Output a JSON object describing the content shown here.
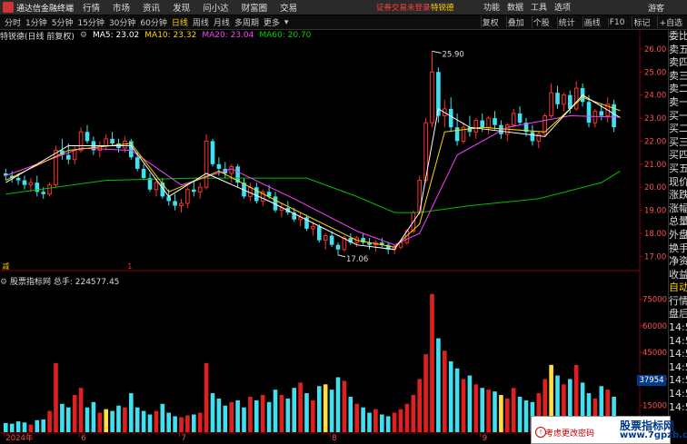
{
  "titlebar": {
    "app_title": "通达信金融终端",
    "menu": [
      "行情",
      "市场",
      "资讯",
      "发现",
      "问小达",
      "财富圈",
      "交易"
    ],
    "notice": "证券交易未登录",
    "stock_name": "特锐德",
    "right_menu": [
      "功能",
      "数据",
      "工具",
      "选项"
    ],
    "guest": "游客"
  },
  "toolbar": {
    "periods": [
      "分时",
      "1分钟",
      "5分钟",
      "15分钟",
      "30分钟",
      "60分钟",
      "日线",
      "周线",
      "月线",
      "多周期",
      "更多"
    ],
    "active_period": "日线",
    "tools": [
      "复权",
      "叠加",
      "个股",
      "统计",
      "画线",
      "F10",
      "标记",
      "+自选"
    ]
  },
  "main_info": {
    "label": "特锐德(日线 前复权)",
    "ma5": "MA5: 23.02",
    "ma10": "MA10: 23.32",
    "ma20": "MA20: 23.04",
    "ma60": "MA60: 20.70",
    "colors": {
      "ma5": "#ffffff",
      "ma10": "#ffd700",
      "ma20": "#ff40ff",
      "ma60": "#00d000"
    }
  },
  "vol_info": {
    "label": "股票指标网",
    "total": "总手: 224577.45"
  },
  "chart_data": {
    "type": "candlestick",
    "price_ticks": [
      "26.00",
      "25.00",
      "24.00",
      "23.00",
      "22.00",
      "21.00",
      "20.00",
      "19.00",
      "18.00",
      "17.00"
    ],
    "price_range": [
      16.7,
      26.35
    ],
    "vol_ticks": [
      "75000",
      "60000",
      "45000",
      "30000",
      "15000"
    ],
    "vol_range": [
      0,
      82000
    ],
    "vol_marker": "37954",
    "x_labels": [
      "2024年",
      "6",
      "7",
      "8",
      "9",
      "10",
      "11"
    ],
    "x_label_index": [
      0,
      12,
      28,
      52,
      76,
      95,
      118
    ],
    "high_label": "25.90",
    "low_label": "17.06",
    "markers": [
      {
        "text": "减",
        "index": 0,
        "color": "#ffd000"
      },
      {
        "text": "1",
        "index": 20,
        "color": "#ff3030"
      },
      {
        "text": "财",
        "index": 110,
        "color": "#4aa0ff"
      }
    ],
    "candles": [
      [
        20.6,
        20.8,
        20.3,
        20.5
      ],
      [
        20.5,
        20.7,
        20.2,
        20.4
      ],
      [
        20.4,
        20.6,
        20.1,
        20.3
      ],
      [
        20.3,
        20.5,
        19.9,
        20.1
      ],
      [
        20.1,
        20.4,
        19.8,
        20.2
      ],
      [
        20.2,
        20.5,
        19.6,
        19.8
      ],
      [
        19.8,
        20.0,
        19.5,
        19.7
      ],
      [
        19.7,
        20.2,
        19.6,
        20.1
      ],
      [
        20.1,
        21.8,
        20.0,
        21.6
      ],
      [
        21.6,
        22.1,
        21.2,
        21.4
      ],
      [
        21.4,
        21.9,
        21.0,
        21.2
      ],
      [
        21.2,
        21.8,
        21.0,
        21.6
      ],
      [
        21.6,
        22.6,
        21.5,
        22.4
      ],
      [
        22.4,
        22.7,
        21.9,
        22.0
      ],
      [
        22.0,
        22.2,
        21.4,
        21.6
      ],
      [
        21.6,
        22.0,
        21.3,
        21.8
      ],
      [
        21.8,
        22.3,
        21.6,
        22.1
      ],
      [
        22.1,
        22.4,
        21.8,
        21.9
      ],
      [
        21.9,
        22.1,
        21.5,
        21.7
      ],
      [
        21.7,
        22.2,
        21.5,
        22.0
      ],
      [
        22.0,
        22.1,
        21.2,
        21.3
      ],
      [
        21.3,
        21.5,
        20.7,
        20.8
      ],
      [
        20.8,
        21.0,
        20.3,
        20.4
      ],
      [
        20.4,
        20.6,
        19.8,
        19.9
      ],
      [
        19.9,
        20.3,
        19.6,
        20.2
      ],
      [
        20.2,
        20.4,
        19.5,
        19.6
      ],
      [
        19.6,
        19.9,
        19.2,
        19.4
      ],
      [
        19.4,
        19.7,
        19.0,
        19.2
      ],
      [
        19.2,
        19.5,
        18.9,
        19.3
      ],
      [
        19.3,
        20.0,
        19.1,
        19.9
      ],
      [
        19.9,
        20.3,
        19.6,
        19.8
      ],
      [
        19.8,
        20.2,
        19.5,
        20.0
      ],
      [
        20.0,
        22.3,
        19.9,
        22.0
      ],
      [
        22.0,
        22.1,
        20.9,
        21.0
      ],
      [
        21.0,
        21.3,
        20.5,
        20.8
      ],
      [
        20.8,
        21.1,
        20.4,
        20.6
      ],
      [
        20.6,
        21.0,
        20.2,
        20.9
      ],
      [
        20.9,
        21.0,
        20.0,
        20.2
      ],
      [
        20.2,
        20.4,
        19.5,
        19.6
      ],
      [
        19.6,
        20.2,
        19.4,
        20.0
      ],
      [
        20.0,
        20.2,
        19.3,
        19.4
      ],
      [
        19.4,
        19.9,
        19.2,
        19.8
      ],
      [
        19.8,
        20.1,
        19.5,
        19.6
      ],
      [
        19.6,
        19.8,
        18.9,
        19.0
      ],
      [
        19.0,
        19.3,
        18.7,
        19.1
      ],
      [
        19.1,
        19.4,
        18.8,
        18.9
      ],
      [
        18.9,
        19.1,
        18.5,
        18.6
      ],
      [
        18.6,
        18.9,
        18.3,
        18.7
      ],
      [
        18.7,
        18.8,
        18.1,
        18.2
      ],
      [
        18.2,
        18.5,
        17.9,
        18.3
      ],
      [
        18.3,
        18.4,
        17.6,
        17.7
      ],
      [
        17.7,
        18.0,
        17.3,
        17.9
      ],
      [
        17.9,
        18.1,
        17.4,
        17.5
      ],
      [
        17.5,
        17.6,
        17.06,
        17.3
      ],
      [
        17.3,
        17.9,
        17.2,
        17.8
      ],
      [
        17.8,
        18.0,
        17.5,
        17.6
      ],
      [
        17.6,
        17.9,
        17.4,
        17.8
      ],
      [
        17.8,
        18.0,
        17.5,
        17.6
      ],
      [
        17.6,
        17.8,
        17.3,
        17.5
      ],
      [
        17.5,
        17.7,
        17.2,
        17.6
      ],
      [
        17.6,
        17.8,
        17.4,
        17.5
      ],
      [
        17.5,
        17.6,
        17.1,
        17.3
      ],
      [
        17.3,
        17.5,
        17.1,
        17.4
      ],
      [
        17.4,
        17.7,
        17.3,
        17.6
      ],
      [
        17.6,
        18.2,
        17.5,
        18.1
      ],
      [
        18.1,
        19.0,
        18.0,
        18.9
      ],
      [
        18.9,
        20.5,
        18.8,
        20.3
      ],
      [
        20.3,
        23.0,
        20.2,
        22.8
      ],
      [
        22.8,
        25.9,
        22.6,
        25.0
      ],
      [
        25.0,
        25.2,
        22.8,
        23.1
      ],
      [
        23.1,
        23.8,
        22.6,
        23.4
      ],
      [
        23.4,
        23.9,
        22.4,
        22.6
      ],
      [
        22.6,
        23.2,
        21.8,
        22.0
      ],
      [
        22.0,
        22.8,
        21.9,
        22.6
      ],
      [
        22.6,
        23.1,
        22.2,
        22.4
      ],
      [
        22.4,
        23.0,
        22.1,
        22.9
      ],
      [
        22.9,
        23.2,
        22.4,
        22.6
      ],
      [
        22.6,
        23.1,
        22.3,
        23.0
      ],
      [
        23.0,
        23.3,
        22.5,
        22.7
      ],
      [
        22.7,
        22.9,
        22.1,
        22.3
      ],
      [
        22.3,
        22.8,
        22.0,
        22.7
      ],
      [
        22.7,
        23.4,
        22.6,
        23.2
      ],
      [
        23.2,
        23.5,
        22.7,
        22.8
      ],
      [
        22.8,
        23.0,
        22.2,
        22.4
      ],
      [
        22.4,
        22.7,
        21.8,
        22.0
      ],
      [
        22.0,
        22.4,
        21.7,
        22.3
      ],
      [
        22.3,
        23.2,
        22.2,
        23.1
      ],
      [
        23.1,
        24.5,
        23.0,
        24.1
      ],
      [
        24.1,
        24.4,
        23.4,
        23.6
      ],
      [
        23.6,
        24.1,
        23.3,
        24.0
      ],
      [
        24.0,
        24.2,
        23.2,
        23.4
      ],
      [
        23.4,
        24.6,
        23.3,
        24.3
      ],
      [
        24.3,
        24.5,
        23.5,
        23.7
      ],
      [
        23.7,
        24.0,
        22.6,
        22.8
      ],
      [
        22.8,
        23.4,
        22.6,
        23.3
      ],
      [
        23.3,
        23.6,
        22.9,
        23.1
      ],
      [
        23.1,
        23.9,
        22.8,
        23.6
      ],
      [
        23.6,
        23.8,
        22.4,
        22.6
      ]
    ],
    "volumes": [
      5200,
      4800,
      6100,
      5500,
      4300,
      6800,
      7200,
      12000,
      39000,
      16000,
      14000,
      21000,
      25000,
      14000,
      17000,
      11000,
      13000,
      12000,
      15000,
      14000,
      22000,
      14000,
      12000,
      10000,
      12000,
      16000,
      11000,
      9000,
      8500,
      9500,
      10000,
      11000,
      39000,
      22000,
      19000,
      15000,
      17000,
      18000,
      14000,
      20000,
      18000,
      21000,
      17000,
      24000,
      21000,
      19000,
      25000,
      28000,
      22000,
      18000,
      26000,
      27000,
      24000,
      31000,
      29000,
      20000,
      16000,
      14000,
      11000,
      13000,
      10000,
      9000,
      11000,
      13000,
      16000,
      21000,
      30000,
      44000,
      78000,
      53000,
      46000,
      40000,
      36000,
      30000,
      32000,
      27000,
      25000,
      24000,
      23000,
      21000,
      19000,
      25000,
      20000,
      18000,
      17000,
      22000,
      30000,
      38000,
      32000,
      27000,
      30000,
      37954,
      28000,
      22000,
      19000,
      26000,
      24000,
      20000
    ],
    "yellow_vol_index": [
      16,
      51,
      79,
      87
    ],
    "ma_series": {
      "ma60": [
        [
          0,
          19.7
        ],
        [
          16,
          20.3
        ],
        [
          30,
          20.4
        ],
        [
          48,
          20.4
        ],
        [
          56,
          19.6
        ],
        [
          62,
          18.9
        ],
        [
          66,
          18.9
        ],
        [
          74,
          19.2
        ],
        [
          85,
          19.5
        ],
        [
          95,
          20.2
        ],
        [
          98,
          20.7
        ]
      ],
      "ma20": [
        [
          0,
          20.5
        ],
        [
          12,
          21.7
        ],
        [
          20,
          21.6
        ],
        [
          28,
          20.1
        ],
        [
          36,
          20.8
        ],
        [
          46,
          19.5
        ],
        [
          56,
          18.1
        ],
        [
          62,
          17.5
        ],
        [
          66,
          18.0
        ],
        [
          72,
          21.4
        ],
        [
          80,
          22.6
        ],
        [
          90,
          23.1
        ],
        [
          98,
          23.04
        ]
      ],
      "ma10": [
        [
          0,
          20.3
        ],
        [
          10,
          21.6
        ],
        [
          20,
          21.9
        ],
        [
          26,
          19.8
        ],
        [
          34,
          20.7
        ],
        [
          44,
          19.3
        ],
        [
          56,
          17.7
        ],
        [
          62,
          17.4
        ],
        [
          66,
          18.4
        ],
        [
          70,
          22.4
        ],
        [
          76,
          22.6
        ],
        [
          86,
          22.4
        ],
        [
          92,
          23.9
        ],
        [
          98,
          23.32
        ]
      ],
      "ma5": [
        [
          0,
          20.2
        ],
        [
          10,
          21.8
        ],
        [
          20,
          21.8
        ],
        [
          26,
          19.6
        ],
        [
          32,
          20.6
        ],
        [
          42,
          19.4
        ],
        [
          56,
          17.5
        ],
        [
          62,
          17.3
        ],
        [
          66,
          18.9
        ],
        [
          69,
          23.4
        ],
        [
          74,
          22.6
        ],
        [
          86,
          22.2
        ],
        [
          92,
          24.0
        ],
        [
          98,
          23.02
        ]
      ]
    }
  },
  "right_panel": {
    "items": [
      "委比",
      "卖五",
      "卖四",
      "卖三",
      "卖二",
      "卖一",
      "买一",
      "买二",
      "买三",
      "买四",
      "买五",
      "现价",
      "涨跌",
      "涨幅",
      "总量",
      "外盘",
      "换手",
      "净资",
      "收益",
      "",
      "自动",
      "行情",
      "盘后",
      "14:50",
      "14:50",
      "14:50",
      "14:50",
      "14:50",
      "14:50",
      "14:50"
    ],
    "colors": [
      "#ddd",
      "#ddd",
      "#ddd",
      "#ddd",
      "#ddd",
      "#ddd",
      "#ddd",
      "#ddd",
      "#ddd",
      "#ddd",
      "#ddd",
      "#ddd",
      "#ddd",
      "#ddd",
      "#ddd",
      "#ddd",
      "#ddd",
      "#ddd",
      "#ddd",
      "#ddd",
      "#ffd000",
      "#ddd",
      "#ddd",
      "#ddd",
      "#ddd",
      "#ddd",
      "#ddd",
      "#ddd",
      "#ddd",
      "#ddd"
    ]
  },
  "watermark": {
    "title": "股票指标网",
    "url": "www.7gpzb.com",
    "note": "考虑更改密码"
  }
}
